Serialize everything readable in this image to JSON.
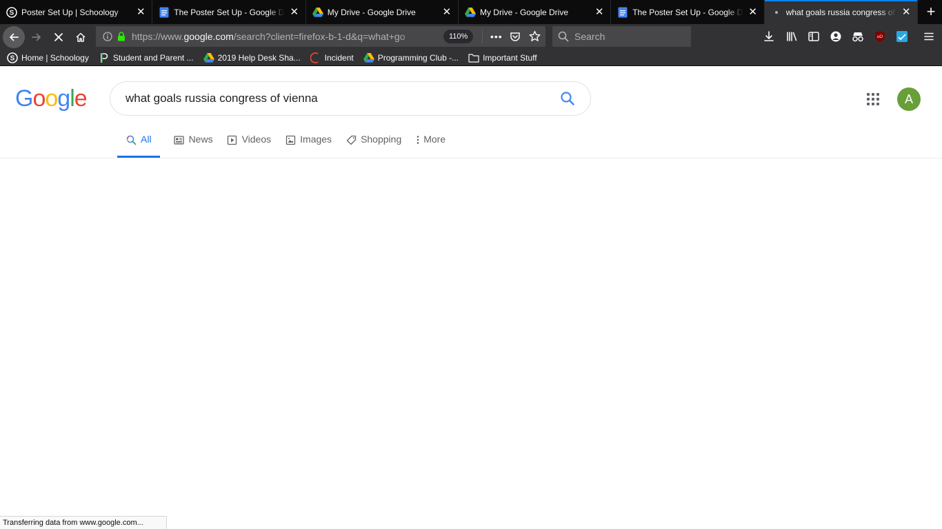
{
  "browser": {
    "tabs": [
      {
        "title": "Poster Set Up | Schoology",
        "icon": "schoology-icon"
      },
      {
        "title": "The Poster Set Up - Google Do",
        "icon": "google-docs-icon"
      },
      {
        "title": "My Drive - Google Drive",
        "icon": "google-drive-icon"
      },
      {
        "title": "My Drive - Google Drive",
        "icon": "google-drive-icon"
      },
      {
        "title": "The Poster Set Up - Google Do",
        "icon": "google-docs-icon"
      },
      {
        "title": "what goals russia congress of v",
        "icon": "loading-dot-icon",
        "active": true
      }
    ],
    "url": {
      "prefix": "https://www.",
      "domain": "google.com",
      "suffix": "/search?client=firefox-b-1-d&q=what+go"
    },
    "zoom": "110%",
    "search_placeholder": "Search",
    "bookmarks": [
      {
        "label": "Home | Schoology",
        "icon": "schoology-icon"
      },
      {
        "label": "Student and Parent ...",
        "icon": "powerschool-icon"
      },
      {
        "label": "2019 Help Desk Sha...",
        "icon": "google-drive-icon"
      },
      {
        "label": "Incident",
        "icon": "incident-icon"
      },
      {
        "label": "Programming Club -...",
        "icon": "google-drive-icon"
      },
      {
        "label": "Important Stuff",
        "icon": "folder-icon"
      }
    ]
  },
  "google": {
    "logo": [
      "G",
      "o",
      "o",
      "g",
      "l",
      "e"
    ],
    "query": "what goals russia congress of vienna",
    "avatar_letter": "A",
    "tabs": [
      {
        "label": "All",
        "icon": "search-icon",
        "active": true
      },
      {
        "label": "News",
        "icon": "news-icon"
      },
      {
        "label": "Videos",
        "icon": "video-icon"
      },
      {
        "label": "Images",
        "icon": "image-icon"
      },
      {
        "label": "Shopping",
        "icon": "tag-icon"
      },
      {
        "label": "More",
        "icon": "more-vert-icon"
      }
    ],
    "colors": {
      "blue": "#4285f4",
      "red": "#ea4335",
      "yellow": "#fbbc05",
      "green": "#34a853",
      "active_tab": "#1a73e8",
      "avatar": "#689f38"
    }
  },
  "status": "Transferring data from www.google.com..."
}
